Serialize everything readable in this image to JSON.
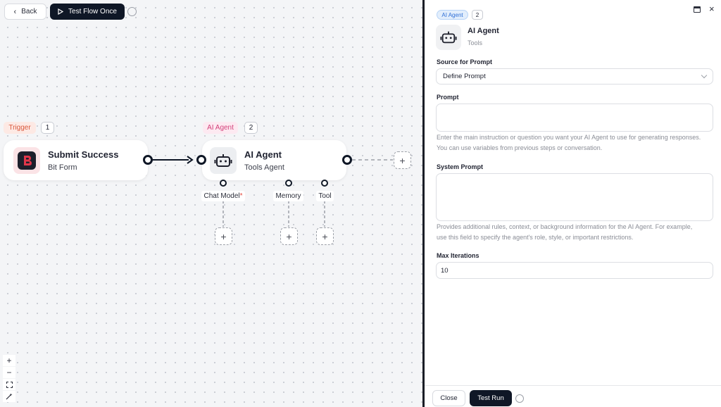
{
  "toolbar": {
    "back_label": "Back",
    "test_flow_label": "Test Flow Once"
  },
  "canvas": {
    "trigger_tag": "Trigger",
    "trigger_index": "1",
    "agent_tag": "AI Agent",
    "agent_index": "2",
    "trigger_node": {
      "title": "Submit Success",
      "subtitle": "Bit Form"
    },
    "agent_node": {
      "title": "AI Agent",
      "subtitle": "Tools Agent"
    },
    "sub_ports": {
      "chat_model": "Chat Model",
      "required_mark": "*",
      "memory": "Memory",
      "tool": "Tool"
    },
    "plus": "+",
    "zoom": {
      "in": "+",
      "out": "−"
    }
  },
  "panel": {
    "tag": "AI Agent",
    "index": "2",
    "title": "AI Agent",
    "subtitle": "Tools",
    "close_icon": "×",
    "source_label": "Source for Prompt",
    "source_value": "Define Prompt",
    "prompt_label": "Prompt",
    "prompt_value": "",
    "prompt_help": "Enter the main instruction or question you want your AI Agent to use for generating responses. You can use variables from previous steps or conversation.",
    "system_label": "System Prompt",
    "system_value": "",
    "system_help": "Provides additional rules, context, or background information for the AI Agent. For example, use this field to specify the agent's role, style, or important restrictions.",
    "iterations_label": "Max Iterations",
    "iterations_value": "10",
    "close_button": "Close",
    "test_run_button": "Test Run"
  },
  "colors": {
    "dark": "#0f1726",
    "trigger_tag": "#d9573b",
    "agent_tag": "#d2417a",
    "bitform_brand": "#e0364a",
    "panel_tag": "#2f6fd6"
  },
  "icons": [
    "chevron-left-icon",
    "play-icon",
    "clock-check-icon",
    "bit-form-logo",
    "robot-icon",
    "zoom-in-icon",
    "zoom-out-icon",
    "fit-view-icon",
    "magic-wand-icon",
    "expand-icon",
    "close-icon"
  ]
}
